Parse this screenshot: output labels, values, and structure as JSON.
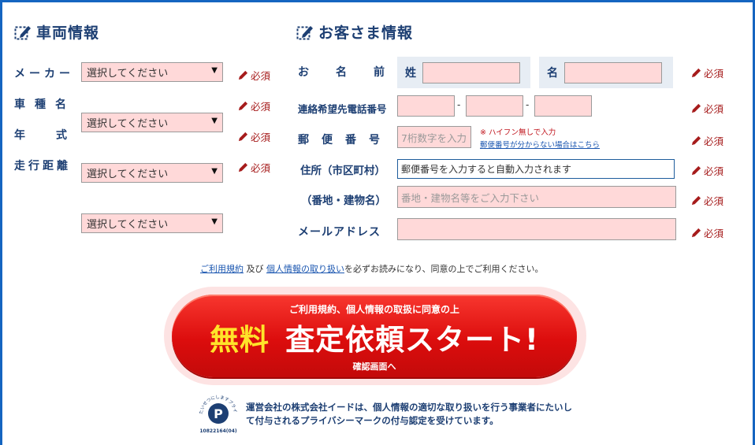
{
  "vehicle": {
    "title": "車両情報",
    "fields": [
      {
        "label": "メーカー",
        "value": "選択してください"
      },
      {
        "label": "車種名",
        "value": "選択してください"
      },
      {
        "label": "年式",
        "value": "選択してください"
      },
      {
        "label": "走行距離",
        "value": "選択してください"
      }
    ]
  },
  "customer": {
    "title": "お客さま情報",
    "name_label": "お名前",
    "last_name_label": "姓",
    "first_name_label": "名",
    "phone_label": "連絡希望先電話番号",
    "phone_sep": "-",
    "postal_label": "郵便番号",
    "postal_placeholder": "7桁数字を入力",
    "postal_note": "※ ハイフン無しで入力",
    "postal_link": "郵便番号が分からない場合はこちら",
    "address1_label": "住所（市区町村）",
    "address1_value": "郵便番号を入力すると自動入力されます",
    "address2_label": "（番地・建物名）",
    "address2_placeholder": "番地・建物名等をご入力下さい",
    "email_label": "メールアドレス"
  },
  "required": "必須",
  "agreement": {
    "terms_link": "ご利用規約",
    "and": "及び",
    "privacy_link": "個人情報の取り扱い",
    "rest": "を必ずお読みになり、同意の上でご利用ください。"
  },
  "cta": {
    "top": "ご利用規約、個人情報の取扱に同意の上",
    "free": "無料",
    "main": "査定依頼スタート!",
    "sub": "確認画面へ"
  },
  "privacy_mark": {
    "arc_text": "たいせつにしますプライバシー",
    "number": "10822164(04)",
    "line1": "運営会社の株式会社イードは、個人情報の適切な取り扱いを行う事業者にたいし",
    "line2": "て付与されるプライバシーマークの付与認定を受けています。"
  },
  "colors": {
    "accent": "#1565c0",
    "field_bg": "#ffd9d9",
    "required": "#a61c1c",
    "cta": "#e01414",
    "cta_free": "#ffe32a"
  }
}
